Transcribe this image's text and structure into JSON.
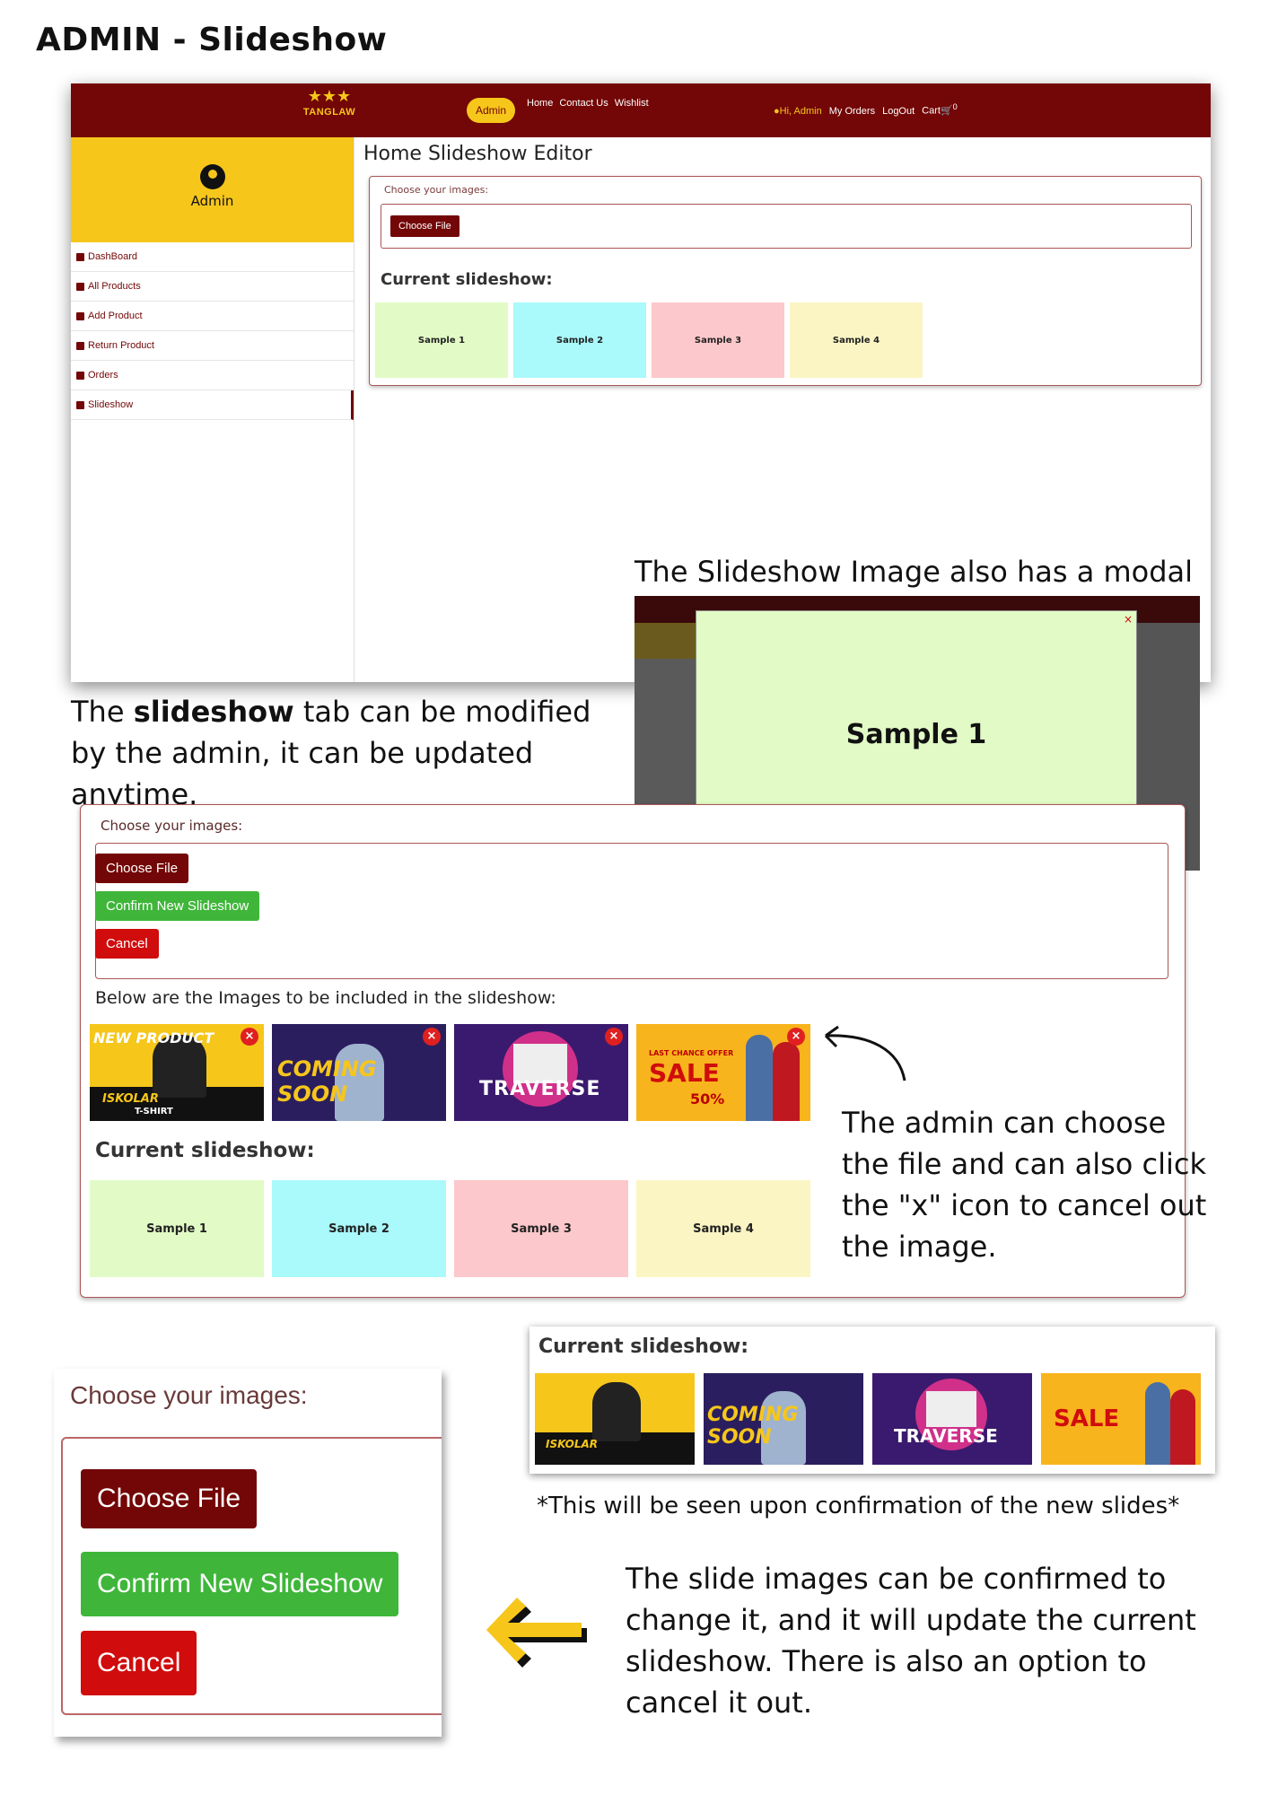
{
  "page_title": "ADMIN - Slideshow",
  "colors": {
    "brand_dark_red": "#730606",
    "brand_yellow": "#f6c61b",
    "confirm_green": "#3fb63a",
    "cancel_red": "#d00c0c",
    "sample1": "#e2fbc6",
    "sample2": "#aaf9fb",
    "sample3": "#fdc8cb",
    "sample4": "#fbf5c4"
  },
  "navbar": {
    "logo_text": "TANGLAW",
    "admin_label": "Admin",
    "links": [
      "Home",
      "Contact Us",
      "Wishlist"
    ],
    "greeting": "Hi, Admin",
    "right_links": [
      "My Orders",
      "LogOut",
      "Cart"
    ],
    "cart_count": "0"
  },
  "sidebar": {
    "user": "Admin",
    "items": [
      {
        "label": "DashBoard",
        "icon": "dashboard-icon"
      },
      {
        "label": "All Products",
        "icon": "products-icon"
      },
      {
        "label": "Add Product",
        "icon": "add-product-icon"
      },
      {
        "label": "Return Product",
        "icon": "return-icon"
      },
      {
        "label": "Orders",
        "icon": "orders-icon"
      },
      {
        "label": "Slideshow",
        "icon": "slideshow-icon"
      }
    ]
  },
  "editor": {
    "title": "Home Slideshow Editor",
    "choose_label": "Choose your images:",
    "choose_button": "Choose File",
    "confirm_button": "Confirm New Slideshow",
    "cancel_button": "Cancel",
    "below_label": "Below are the Images to be included in the slideshow:",
    "current_label": "Current slideshow:",
    "samples": [
      "Sample 1",
      "Sample 2",
      "Sample 3",
      "Sample 4"
    ],
    "close_symbol": "×"
  },
  "banners": {
    "b1_main": "ISKOLAR",
    "b1_sub": "T-SHIRT",
    "b1_top": "NEW PRODUCT",
    "b2_main": "COMING SOON",
    "b3_main": "TRAVERSE",
    "b4_top": "LAST CHANCE OFFER",
    "b4_main": "SALE",
    "b4_sub": "50%"
  },
  "modal": {
    "caption": "The Slideshow Image also has a modal",
    "text": "Sample 1",
    "close": "×"
  },
  "captions": {
    "desc1_pre": "The ",
    "desc1_bold": "slideshow",
    "desc1_post": " tab can be modified by the admin, it can be updated anytime.",
    "desc2": "The admin can choose the file and can also click the \"x\" icon to cancel out the image.",
    "note": "*This will be seen upon confirmation of the new slides*",
    "desc3": "The slide images can be confirmed to change it, and it will update the current slideshow. There is also an option to cancel it out."
  }
}
